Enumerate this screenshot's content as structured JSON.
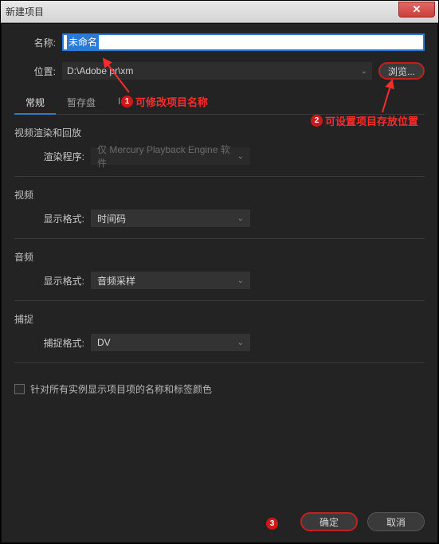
{
  "window": {
    "title": "新建项目",
    "close_glyph": "✕"
  },
  "fields": {
    "name_label": "名称:",
    "name_value": "未命名",
    "location_label": "位置:",
    "location_value": "D:\\Adobe pr\\xm",
    "browse_label": "浏览..."
  },
  "tabs": {
    "general": "常规",
    "scratch": "暂存盘",
    "ingest_prefix": "I"
  },
  "sections": {
    "render": {
      "title": "视频渲染和回放",
      "renderer_label": "渲染程序:",
      "renderer_value": "仅 Mercury Playback Engine 软件"
    },
    "video": {
      "title": "视频",
      "format_label": "显示格式:",
      "format_value": "时间码"
    },
    "audio": {
      "title": "音频",
      "format_label": "显示格式:",
      "format_value": "音频采样"
    },
    "capture": {
      "title": "捕捉",
      "format_label": "捕捉格式:",
      "format_value": "DV"
    }
  },
  "checkbox_label": "针对所有实例显示项目项的名称和标签颜色",
  "footer": {
    "ok": "确定",
    "cancel": "取消"
  },
  "annotations": {
    "a1": "可修改项目名称",
    "a2": "可设置项目存放位置",
    "n1": "1",
    "n2": "2",
    "n3": "3"
  },
  "chevron": "⌄"
}
